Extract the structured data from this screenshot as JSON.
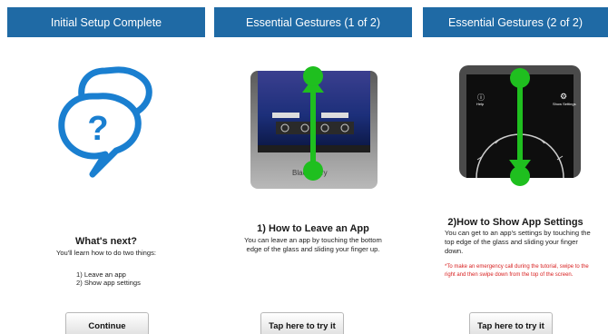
{
  "panels": [
    {
      "header": "Initial Setup Complete",
      "heading": "What's next?",
      "intro": "You'll learn how to do two things:",
      "list": [
        "1) Leave an app",
        "2) Show app settings"
      ],
      "button": "Continue"
    },
    {
      "header": "Essential Gestures (1 of 2)",
      "heading": "1) How to Leave an App",
      "body_line1": "You can leave an app by touching the bottom",
      "body_line2": "edge of the glass and sliding your finger up.",
      "phone_brand": "BlackBerry",
      "button": "Tap here to try it"
    },
    {
      "header": "Essential Gestures (2 of 2)",
      "heading": "2)How to Show App Settings",
      "body_line1": "You can get to an app's settings by touching the",
      "body_line2": "top edge of the glass and sliding your finger",
      "body_line3": "down.",
      "note_line1": "*To make an emergency call during the tutorial, swipe to the",
      "note_line2": "right and then swipe down from the top of the screen.",
      "phone_help": "Help",
      "phone_settings": "Show Settings",
      "button": "Tap here to try it"
    }
  ],
  "colors": {
    "header": "#1f6aa5",
    "bubble": "#1a7fd0",
    "arrow": "#1fbf1f",
    "note": "#d81f1f"
  },
  "icons": [
    "question-bubble-icon",
    "up-arrow-icon",
    "down-arrow-icon",
    "help-icon",
    "gear-icon"
  ]
}
